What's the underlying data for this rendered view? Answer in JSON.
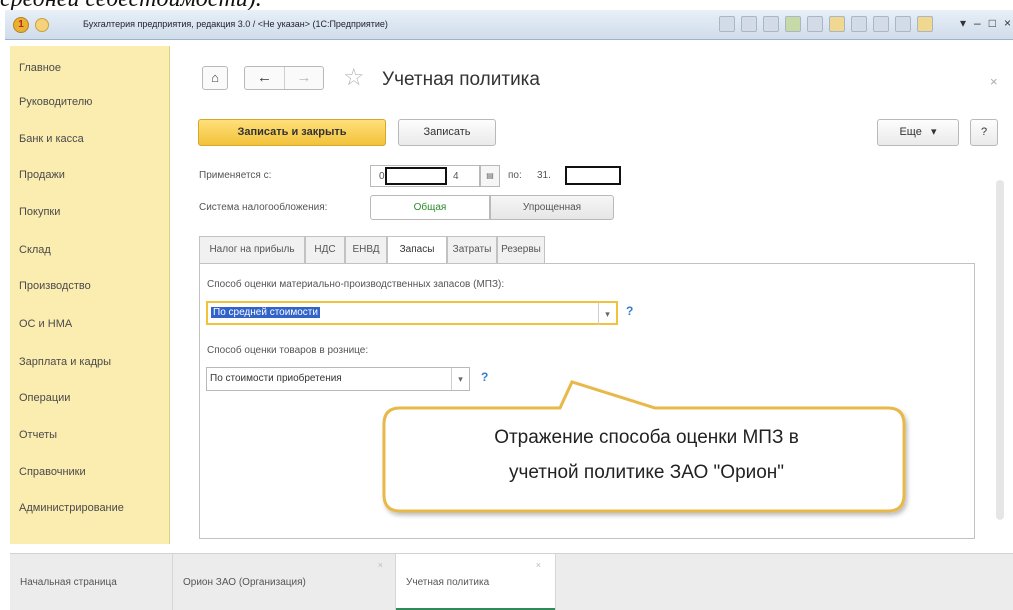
{
  "doc_caption": "средней себестоимости).",
  "titlebar": {
    "text": "Бухгалтерия предприятия, редакция 3.0 / <Не указан> (1С:Предприятие)",
    "win_buttons": [
      "▾",
      "–",
      "□",
      "×"
    ]
  },
  "sidebar": {
    "items": [
      "Главное",
      "Руководителю",
      "Банк и касса",
      "Продажи",
      "Покупки",
      "Склад",
      "Производство",
      "ОС и НМА",
      "Зарплата и кадры",
      "Операции",
      "Отчеты",
      "Справочники",
      "Администрирование"
    ]
  },
  "header": {
    "title": "Учетная политика",
    "close": "×",
    "home_icon": "⌂",
    "back_icon": "←",
    "forward_icon": "→",
    "star_icon": "☆"
  },
  "toolbar": {
    "save_close_label": "Записать и закрыть",
    "save_label": "Записать",
    "more_label": "Еще",
    "more_arrow": "▾",
    "help_label": "?"
  },
  "form": {
    "applies_from_label": "Применяется с:",
    "date_from_prefix": "0",
    "date_from_suffix": "4",
    "to_label": "по:",
    "date_to_prefix": "31.",
    "calendar_icon": "▤",
    "tax_system_label": "Система налогообложения:",
    "tax_system_options": [
      "Общая",
      "Упрощенная"
    ],
    "tax_system_selected": "Общая"
  },
  "tabs": [
    "Налог на прибыль",
    "НДС",
    "ЕНВД",
    "Запасы",
    "Затраты",
    "Резервы"
  ],
  "active_tab": "Запасы",
  "inventory": {
    "mpz_label": "Способ оценки материально-производственных запасов (МПЗ):",
    "mpz_value": "По средней стоимости",
    "retail_label": "Способ оценки товаров в рознице:",
    "retail_value": "По стоимости приобретения",
    "dropdown_arrow": "▾",
    "help": "?"
  },
  "callout": {
    "line1": "Отражение способа оценки МПЗ в",
    "line2": "учетной политике ЗАО \"Орион\""
  },
  "bottom_tabs": [
    {
      "label": "Начальная страница",
      "close": ""
    },
    {
      "label": "Орион ЗАО (Организация)",
      "close": "×"
    },
    {
      "label": "Учетная политика",
      "close": "×"
    }
  ],
  "active_bottom_tab": "Учетная политика",
  "colors": {
    "sidebar_bg": "#fbecb0",
    "primary_button": "#f2c23a",
    "selection": "#3163c8",
    "callout_border": "#e8b84a",
    "active_tab_underline": "#2e8b57"
  }
}
